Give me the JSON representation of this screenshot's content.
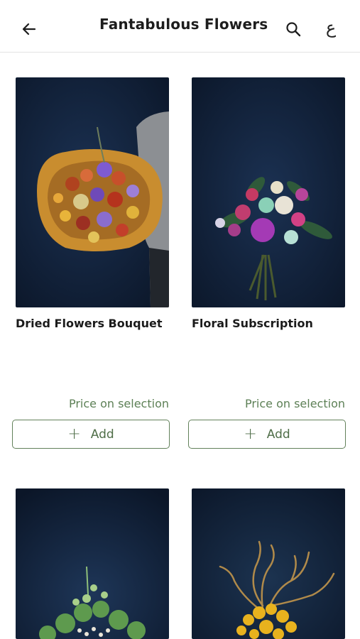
{
  "header": {
    "title": "Fantabulous Flowers",
    "back_icon": "arrow-left-icon",
    "search_icon": "search-icon",
    "language_toggle": "ع"
  },
  "products": [
    {
      "name": "Dried Flowers Bouquet",
      "price": "Price on selection",
      "add_label": "Add"
    },
    {
      "name": "Floral Subscription",
      "price": "Price on selection",
      "add_label": "Add"
    },
    {
      "name": "",
      "price": "",
      "add_label": ""
    },
    {
      "name": "",
      "price": "",
      "add_label": ""
    }
  ],
  "colors": {
    "accent_green": "#5d8056",
    "image_background": "#0f2036"
  }
}
